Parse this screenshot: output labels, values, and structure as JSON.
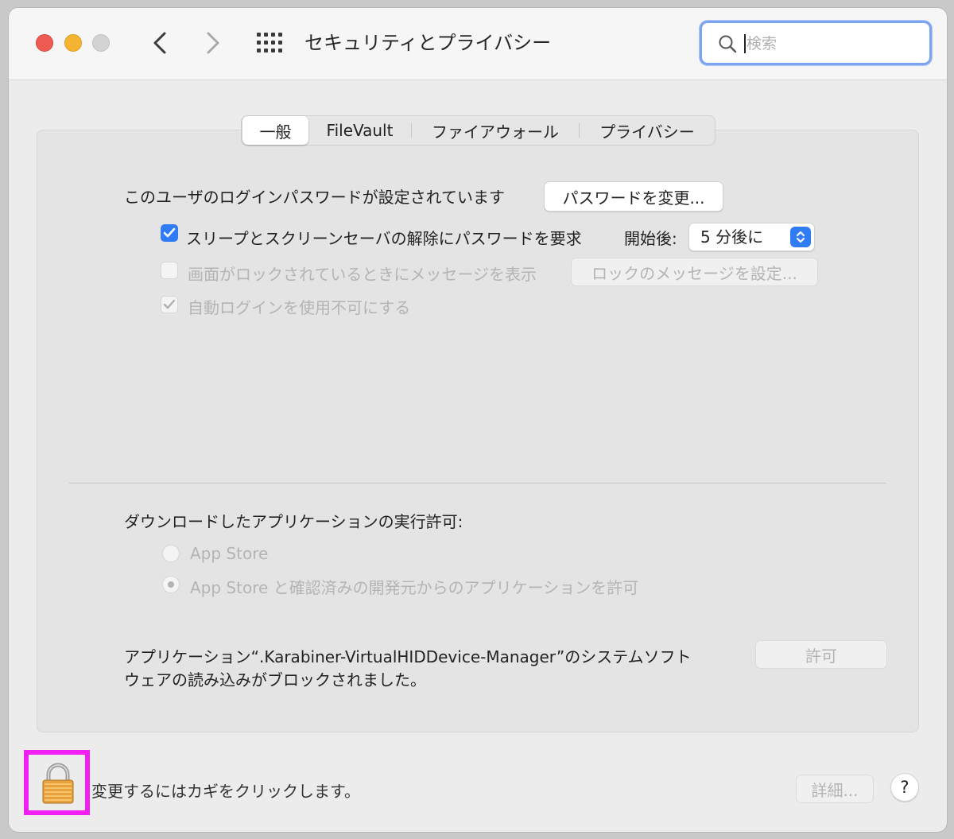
{
  "window": {
    "title": "セキュリティとプライバシー",
    "search_placeholder": "検索"
  },
  "tabs": [
    {
      "label": "一般",
      "active": true
    },
    {
      "label": "FileVault",
      "active": false
    },
    {
      "label": "ファイアウォール",
      "active": false
    },
    {
      "label": "プライバシー",
      "active": false
    }
  ],
  "general": {
    "password_set_text": "このユーザのログインパスワードが設定されています",
    "change_password_button": "パスワードを変更...",
    "require_password": {
      "label": "スリープとスクリーンセーバの解除にパスワードを要求",
      "checked": true,
      "after_label": "開始後:",
      "after_value": "5 分後に"
    },
    "show_message": {
      "label": "画面がロックされているときにメッセージを表示",
      "checked": false,
      "enabled": false,
      "set_message_button": "ロックのメッセージを設定..."
    },
    "disable_auto_login": {
      "label": "自動ログインを使用不可にする",
      "checked": true,
      "enabled": false
    }
  },
  "downloads": {
    "heading": "ダウンロードしたアプリケーションの実行許可:",
    "options": [
      {
        "label": "App Store",
        "selected": false
      },
      {
        "label": "App Store と確認済みの開発元からのアプリケーションを許可",
        "selected": true
      }
    ]
  },
  "blocked": {
    "line1": "アプリケーション“.Karabiner-VirtualHIDDevice-Manager”のシステムソフト",
    "line2": "ウェアの読み込みがブロックされました。",
    "allow_button": "許可"
  },
  "footer": {
    "lock_text": "変更するにはカギをクリックします。",
    "advanced_button": "詳細...",
    "help_button": "?"
  },
  "colors": {
    "accent": "#2f7cf6",
    "search_focus": "#7da4f0",
    "highlight_box": "#f21ef2",
    "close": "#ee5b52",
    "minimize": "#f4b431"
  }
}
